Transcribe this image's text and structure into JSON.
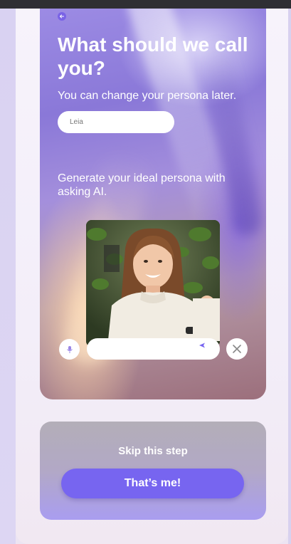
{
  "header": {
    "title": "What should we call you?",
    "subtitle": "You can change your persona later."
  },
  "name_field": {
    "value": "Leia"
  },
  "generate": {
    "text": "Generate your ideal persona with asking AI."
  },
  "prompt": {
    "value": ""
  },
  "actions": {
    "skip_label": "Skip this step",
    "confirm_label": "That’s me!"
  },
  "icons": {
    "back": "arrow-left-icon",
    "mic": "microphone-icon",
    "send": "send-icon",
    "close": "close-icon"
  },
  "colors": {
    "accent": "#7765f0",
    "back_button": "#7a63e6",
    "card_gradient_end": "#a99df0"
  }
}
